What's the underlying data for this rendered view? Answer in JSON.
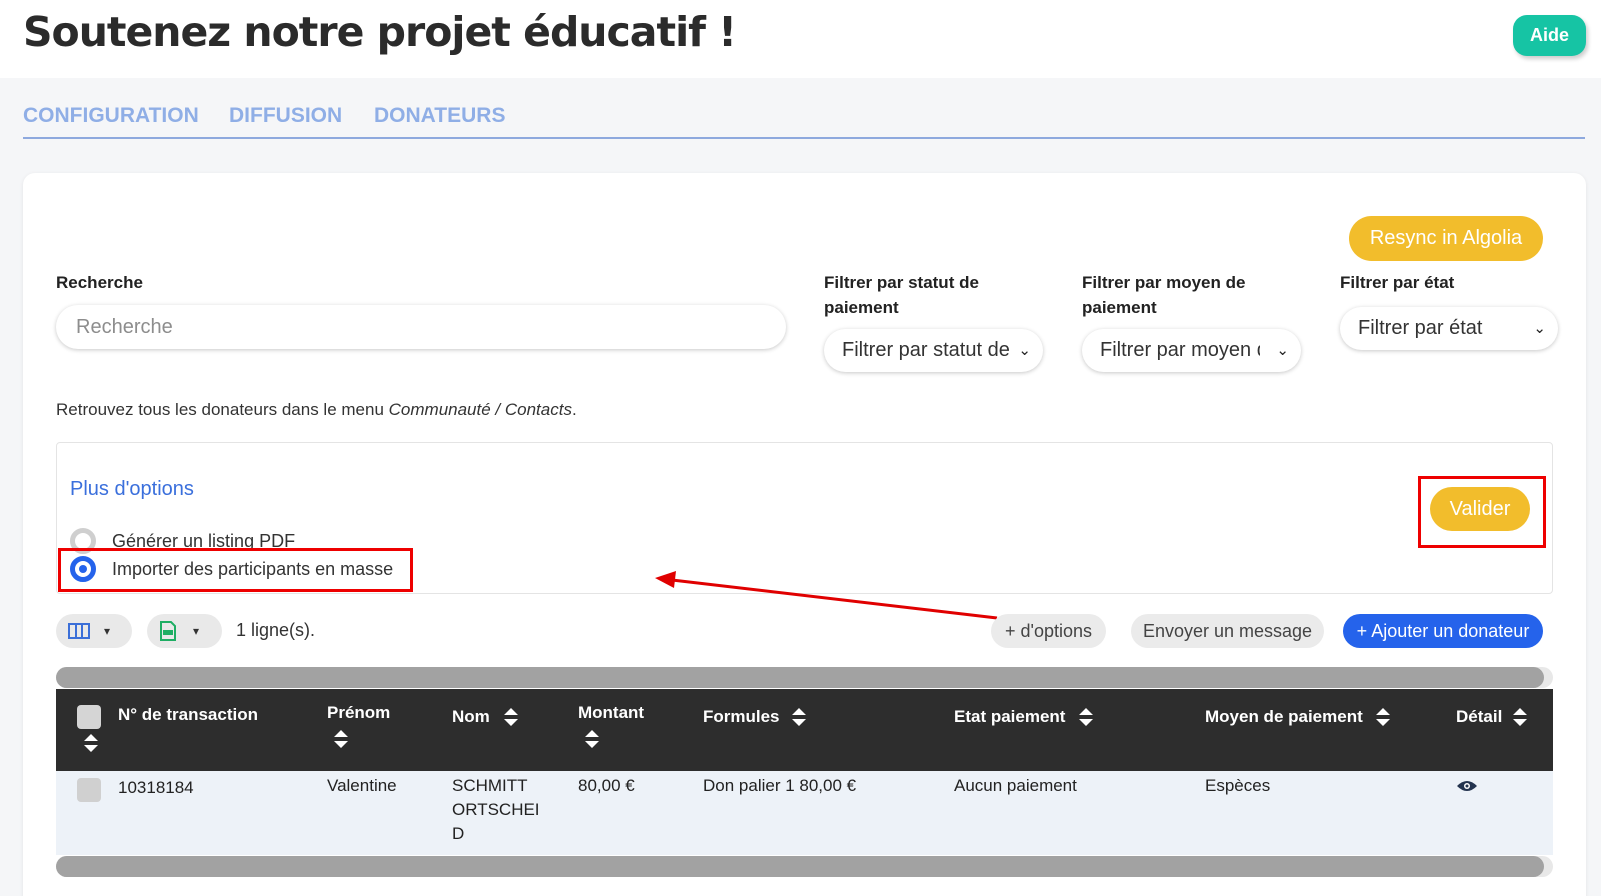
{
  "header": {
    "title": "Soutenez notre projet éducatif !",
    "help_label": "Aide"
  },
  "tabs": [
    {
      "label": "CONFIGURATION"
    },
    {
      "label": "DIFFUSION"
    },
    {
      "label": "DONATEURS"
    }
  ],
  "resync_label": "Resync in Algolia",
  "filters": {
    "search_label": "Recherche",
    "search_placeholder": "Recherche",
    "status_label": "Filtrer par statut de paiement",
    "status_value": "Filtrer par statut de paiement",
    "method_label": "Filtrer par moyen de paiement",
    "method_value": "Filtrer par moyen de paiement",
    "state_label": "Filtrer par état",
    "state_value": "Filtrer par état"
  },
  "info": {
    "prefix": "Retrouvez tous les donateurs dans le menu ",
    "link": "Communauté / Contacts",
    "suffix": "."
  },
  "options": {
    "title": "Plus d'options",
    "radio_pdf": "Générer un listing PDF",
    "radio_import": "Importer des participants en masse",
    "selected": "radio_import",
    "validate_label": "Valider"
  },
  "toolbar": {
    "rows_count": "1 ligne(s).",
    "more_options": "+ d'options",
    "send_message": "Envoyer un message",
    "add_donor": "+ Ajouter un donateur"
  },
  "table": {
    "columns": [
      "N° de transaction",
      "Prénom",
      "Nom",
      "Montant",
      "Formules",
      "Etat paiement",
      "Moyen de paiement",
      "Détail"
    ],
    "rows": [
      {
        "transaction": "10318184",
        "first_name": "Valentine",
        "last_name": "SCHMITT ORTSCHEID",
        "amount": "80,00 €",
        "formula": "Don palier 1 80,00 €",
        "payment_state": "Aucun paiement",
        "payment_method": "Espèces"
      }
    ]
  },
  "colors": {
    "accent_blue": "#2563eb",
    "yellow": "#f2bd2c",
    "teal": "#16c4a4",
    "tab_blue": "#8faee6",
    "highlight_red": "#e00000"
  }
}
